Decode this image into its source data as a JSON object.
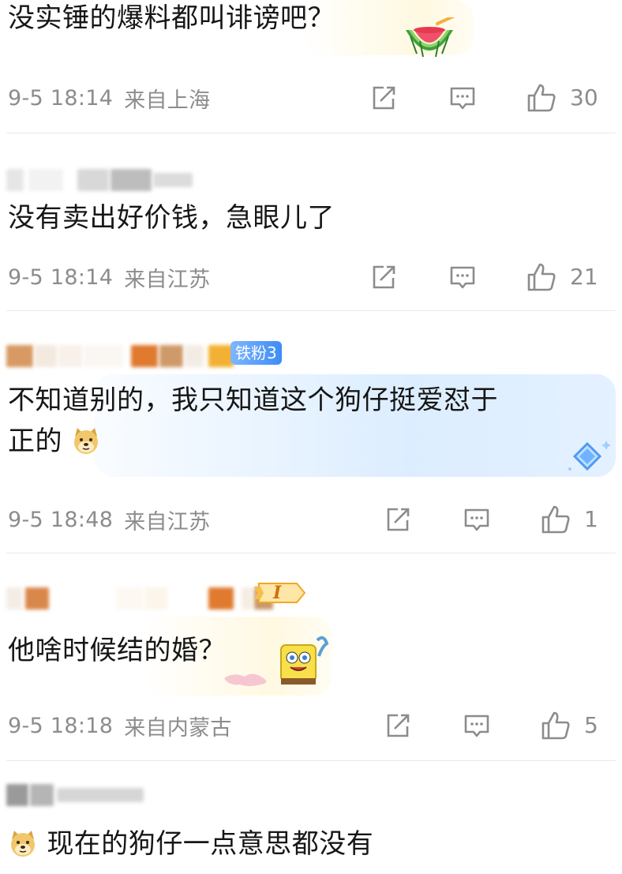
{
  "comments": [
    {
      "text": "没实锤的爆料都叫诽谤吧？",
      "date": "9-5 18:14",
      "location": "来自上海",
      "likes": "30",
      "sticker": "watermelon-sticker"
    },
    {
      "text": "没有卖出好价钱，急眼儿了",
      "date": "9-5 18:14",
      "location": "来自江苏",
      "likes": "21"
    },
    {
      "text_line1": "不知道别的，我只知道这个狗仔挺爱怼于",
      "text_line2": "正的",
      "badge": "铁粉3",
      "date": "9-5 18:48",
      "location": "来自江苏",
      "likes": "1",
      "emoji": "doge-emoji"
    },
    {
      "text": "他啥时候结的婚？",
      "badge": "I",
      "date": "9-5 18:18",
      "location": "来自内蒙古",
      "likes": "5",
      "sticker": "spongebob-sticker"
    },
    {
      "text": "现在的狗仔一点意思都没有",
      "emoji": "doge-emoji"
    }
  ],
  "icons": {
    "share": "share-icon",
    "comment": "comment-icon",
    "like": "thumbs-up-icon"
  },
  "colors": {
    "meta_text": "#8c8c8c",
    "divider": "#e9e9e9",
    "fan_badge": "#3e8cf5",
    "level_badge": "#f5a623"
  }
}
